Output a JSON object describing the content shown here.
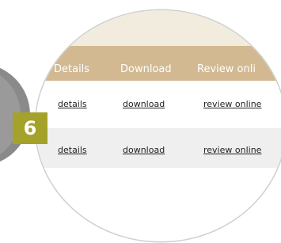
{
  "step_badge": "6",
  "table": {
    "headers": [
      "Details",
      "Download",
      "Review onli"
    ],
    "rows": [
      {
        "details": "details",
        "download": "download",
        "review": "review online"
      },
      {
        "details": "details",
        "download": "download",
        "review": "review online"
      }
    ]
  },
  "colors": {
    "header_bg": "#d2b992",
    "top_band_bg": "#f2ecde",
    "row_alt_bg": "#efefef",
    "badge_bg": "#a4a22a",
    "gray_disc": "#8a8a8a"
  }
}
